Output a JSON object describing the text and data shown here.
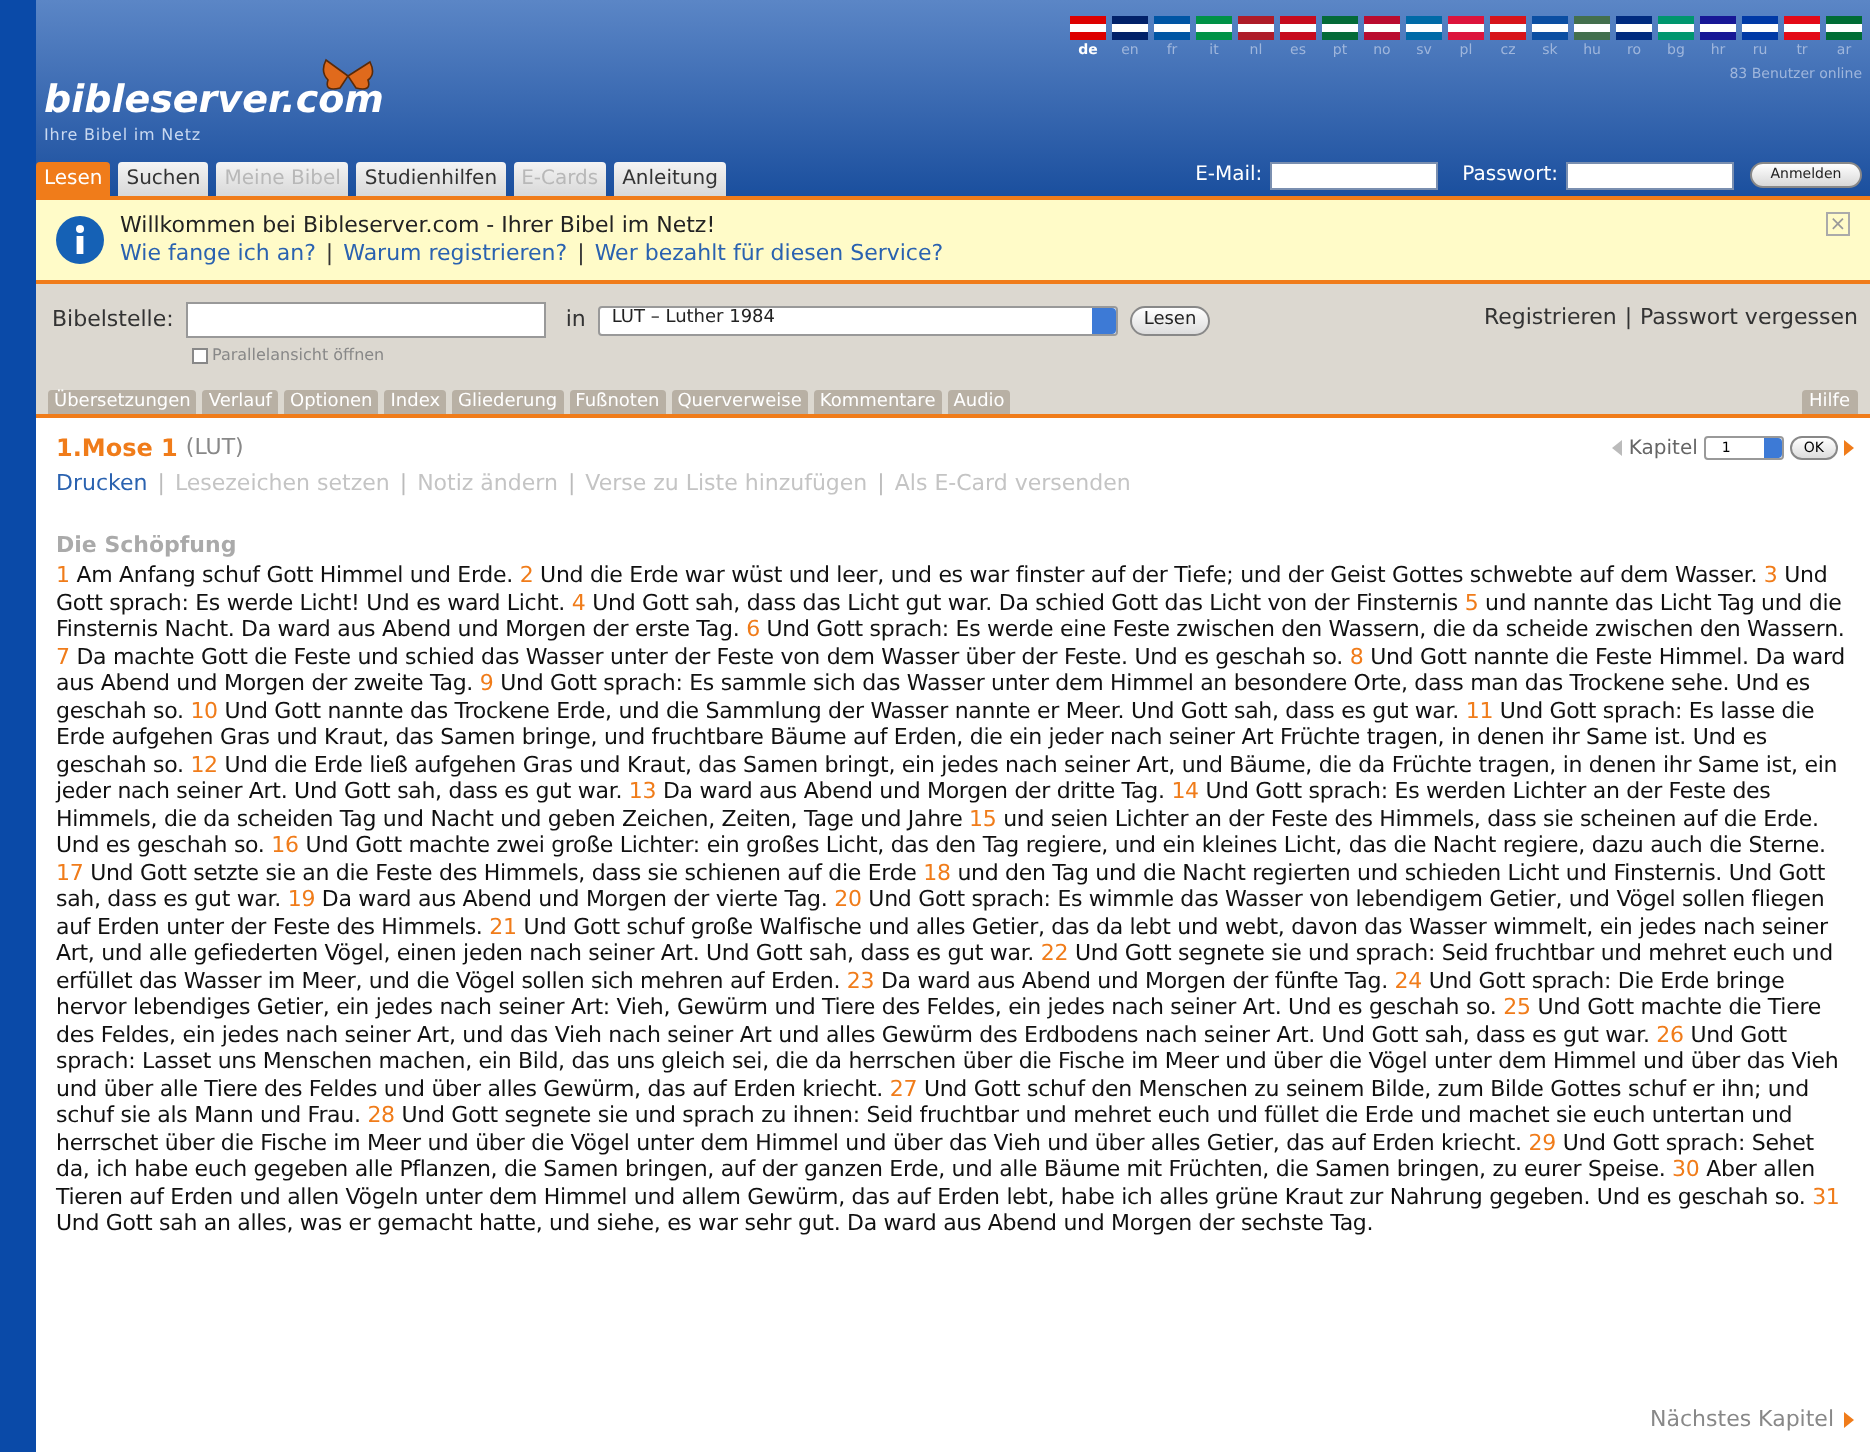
{
  "logo": {
    "name": "bibleserver.com",
    "tagline": "Ihre Bibel im Netz"
  },
  "languages": [
    {
      "code": "de",
      "selected": true,
      "color": "#dd0000"
    },
    {
      "code": "en",
      "selected": false,
      "color": "#012169"
    },
    {
      "code": "fr",
      "selected": false,
      "color": "#0055a4"
    },
    {
      "code": "it",
      "selected": false,
      "color": "#009246"
    },
    {
      "code": "nl",
      "selected": false,
      "color": "#ae1c28"
    },
    {
      "code": "es",
      "selected": false,
      "color": "#c60b1e"
    },
    {
      "code": "pt",
      "selected": false,
      "color": "#046a38"
    },
    {
      "code": "no",
      "selected": false,
      "color": "#ba0c2f"
    },
    {
      "code": "sv",
      "selected": false,
      "color": "#006aa7"
    },
    {
      "code": "pl",
      "selected": false,
      "color": "#dc143c"
    },
    {
      "code": "cz",
      "selected": false,
      "color": "#d7141a"
    },
    {
      "code": "sk",
      "selected": false,
      "color": "#0b4ea2"
    },
    {
      "code": "hu",
      "selected": false,
      "color": "#436f4d"
    },
    {
      "code": "ro",
      "selected": false,
      "color": "#002b7f"
    },
    {
      "code": "bg",
      "selected": false,
      "color": "#00966e"
    },
    {
      "code": "hr",
      "selected": false,
      "color": "#171796"
    },
    {
      "code": "ru",
      "selected": false,
      "color": "#0039a6"
    },
    {
      "code": "tr",
      "selected": false,
      "color": "#e30a17"
    },
    {
      "code": "ar",
      "selected": false,
      "color": "#006c35"
    }
  ],
  "online_count": "83 Benutzer online",
  "nav_tabs": [
    {
      "label": "Lesen",
      "selected": true,
      "disabled": false
    },
    {
      "label": "Suchen",
      "selected": false,
      "disabled": false
    },
    {
      "label": "Meine Bibel",
      "selected": false,
      "disabled": true
    },
    {
      "label": "Studienhilfen",
      "selected": false,
      "disabled": false
    },
    {
      "label": "E-Cards",
      "selected": false,
      "disabled": true
    },
    {
      "label": "Anleitung",
      "selected": false,
      "disabled": false
    }
  ],
  "login": {
    "email_label": "E-Mail:",
    "password_label": "Passwort:",
    "button": "Anmelden"
  },
  "notice": {
    "title": "Willkommen bei Bibleserver.com - Ihrer Bibel im Netz!",
    "links": [
      "Wie fange ich an?",
      "Warum registrieren?",
      "Wer bezahlt für diesen Service?"
    ],
    "separator": "|",
    "close": "×"
  },
  "search": {
    "label": "Bibelstelle:",
    "in_label": "in",
    "translation": "LUT – Luther 1984",
    "button": "Lesen",
    "parallel": {
      "label": "Parallelansicht öffnen",
      "checked": false
    },
    "account_links": [
      "Registrieren",
      "Passwort vergessen"
    ],
    "separator": "|"
  },
  "tool_tabs": [
    "Übersetzungen",
    "Verlauf",
    "Optionen",
    "Index",
    "Gliederung",
    "Fußnoten",
    "Querverweise",
    "Kommentare",
    "Audio"
  ],
  "help_tab": "Hilfe",
  "chapter": {
    "title": "1.Mose 1",
    "translation": "(LUT)",
    "chapter_label": "Kapitel",
    "chapter_value": "1",
    "ok": "OK",
    "separator": "|",
    "actions": [
      {
        "label": "Drucken",
        "disabled": false
      },
      {
        "label": "Lesezeichen setzen",
        "disabled": true
      },
      {
        "label": "Notiz ändern",
        "disabled": true
      },
      {
        "label": "Verse zu Liste hinzufügen",
        "disabled": true
      },
      {
        "label": "Als E-Card versenden",
        "disabled": true
      }
    ],
    "heading": "Die Schöpfung",
    "verses": [
      {
        "n": "1",
        "text": "Am Anfang schuf Gott Himmel und Erde."
      },
      {
        "n": "2",
        "text": "Und die Erde war wüst und leer, und es war finster auf der Tiefe; und der Geist Gottes schwebte auf dem Wasser."
      },
      {
        "n": "3",
        "text": "Und Gott sprach: Es werde Licht! Und es ward Licht."
      },
      {
        "n": "4",
        "text": "Und Gott sah, dass das Licht gut war. Da schied Gott das Licht von der Finsternis"
      },
      {
        "n": "5",
        "text": "und nannte das Licht Tag und die Finsternis Nacht. Da ward aus Abend und Morgen der erste Tag."
      },
      {
        "n": "6",
        "text": "Und Gott sprach: Es werde eine Feste zwischen den Wassern, die da scheide zwischen den Wassern."
      },
      {
        "n": "7",
        "text": "Da machte Gott die Feste und schied das Wasser unter der Feste von dem Wasser über der Feste. Und es geschah so."
      },
      {
        "n": "8",
        "text": "Und Gott nannte die Feste Himmel. Da ward aus Abend und Morgen der zweite Tag."
      },
      {
        "n": "9",
        "text": "Und Gott sprach: Es sammle sich das Wasser unter dem Himmel an besondere Orte, dass man das Trockene sehe. Und es geschah so."
      },
      {
        "n": "10",
        "text": "Und Gott nannte das Trockene Erde, und die Sammlung der Wasser nannte er Meer. Und Gott sah, dass es gut war."
      },
      {
        "n": "11",
        "text": "Und Gott sprach: Es lasse die Erde aufgehen Gras und Kraut, das Samen bringe, und fruchtbare Bäume auf Erden, die ein jeder nach seiner Art Früchte tragen, in denen ihr Same ist. Und es geschah so."
      },
      {
        "n": "12",
        "text": "Und die Erde ließ aufgehen Gras und Kraut, das Samen bringt, ein jedes nach seiner Art, und Bäume, die da Früchte tragen, in denen ihr Same ist, ein jeder nach seiner Art. Und Gott sah, dass es gut war."
      },
      {
        "n": "13",
        "text": "Da ward aus Abend und Morgen der dritte Tag."
      },
      {
        "n": "14",
        "text": "Und Gott sprach: Es werden Lichter an der Feste des Himmels, die da scheiden Tag und Nacht und geben Zeichen, Zeiten, Tage und Jahre"
      },
      {
        "n": "15",
        "text": "und seien Lichter an der Feste des Himmels, dass sie scheinen auf die Erde. Und es geschah so."
      },
      {
        "n": "16",
        "text": "Und Gott machte zwei große Lichter: ein großes Licht, das den Tag regiere, und ein kleines Licht, das die Nacht regiere, dazu auch die Sterne."
      },
      {
        "n": "17",
        "text": "Und Gott setzte sie an die Feste des Himmels, dass sie schienen auf die Erde"
      },
      {
        "n": "18",
        "text": "und den Tag und die Nacht regierten und schieden Licht und Finsternis. Und Gott sah, dass es gut war."
      },
      {
        "n": "19",
        "text": "Da ward aus Abend und Morgen der vierte Tag."
      },
      {
        "n": "20",
        "text": "Und Gott sprach: Es wimmle das Wasser von lebendigem Getier, und Vögel sollen fliegen auf Erden unter der Feste des Himmels."
      },
      {
        "n": "21",
        "text": "Und Gott schuf große Walfische und alles Getier, das da lebt und webt, davon das Wasser wimmelt, ein jedes nach seiner Art, und alle gefiederten Vögel, einen jeden nach seiner Art. Und Gott sah, dass es gut war."
      },
      {
        "n": "22",
        "text": "Und Gott segnete sie und sprach: Seid fruchtbar und mehret euch und erfüllet das Wasser im Meer, und die Vögel sollen sich mehren auf Erden."
      },
      {
        "n": "23",
        "text": "Da ward aus Abend und Morgen der fünfte Tag."
      },
      {
        "n": "24",
        "text": "Und Gott sprach: Die Erde bringe hervor lebendiges Getier, ein jedes nach seiner Art: Vieh, Gewürm und Tiere des Feldes, ein jedes nach seiner Art. Und es geschah so."
      },
      {
        "n": "25",
        "text": "Und Gott machte die Tiere des Feldes, ein jedes nach seiner Art, und das Vieh nach seiner Art und alles Gewürm des Erdbodens nach seiner Art. Und Gott sah, dass es gut war."
      },
      {
        "n": "26",
        "text": "Und Gott sprach: Lasset uns Menschen machen, ein Bild, das uns gleich sei, die da herrschen über die Fische im Meer und über die Vögel unter dem Himmel und über das Vieh und über alle Tiere des Feldes und über alles Gewürm, das auf Erden kriecht."
      },
      {
        "n": "27",
        "text": "Und Gott schuf den Menschen zu seinem Bilde, zum Bilde Gottes schuf er ihn; und schuf sie als Mann und Frau."
      },
      {
        "n": "28",
        "text": "Und Gott segnete sie und sprach zu ihnen: Seid fruchtbar und mehret euch und füllet die Erde und machet sie euch untertan und herrschet über die Fische im Meer und über die Vögel unter dem Himmel und über das Vieh und über alles Getier, das auf Erden kriecht."
      },
      {
        "n": "29",
        "text": "Und Gott sprach: Sehet da, ich habe euch gegeben alle Pflanzen, die Samen bringen, auf der ganzen Erde, und alle Bäume mit Früchten, die Samen bringen, zu eurer Speise."
      },
      {
        "n": "30",
        "text": "Aber allen Tieren auf Erden und allen Vögeln unter dem Himmel und allem Gewürm, das auf Erden lebt, habe ich alles grüne Kraut zur Nahrung gegeben. Und es geschah so."
      },
      {
        "n": "31",
        "text": "Und Gott sah an alles, was er gemacht hatte, und siehe, es war sehr gut. Da ward aus Abend und Morgen der sechste Tag."
      }
    ],
    "next": "Nächstes Kapitel"
  }
}
